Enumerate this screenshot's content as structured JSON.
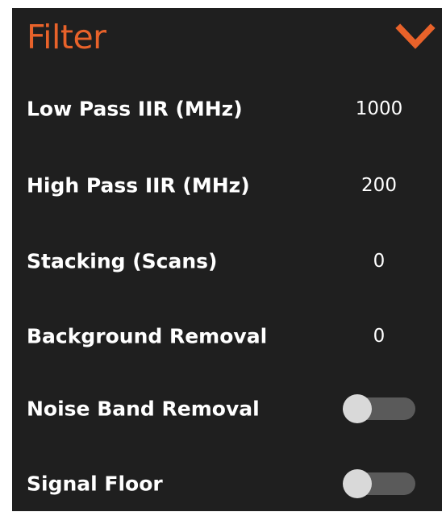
{
  "panel": {
    "title": "Filter",
    "collapse_icon": "chevron-down-icon",
    "accent_color": "#e8622a",
    "background_color": "#1f1f1f"
  },
  "settings": [
    {
      "label": "Low Pass IIR (MHz)",
      "type": "number",
      "value": "1000"
    },
    {
      "label": "High Pass IIR (MHz)",
      "type": "number",
      "value": "200"
    },
    {
      "label": "Stacking (Scans)",
      "type": "number",
      "value": "0"
    },
    {
      "label": "Background Removal",
      "type": "number",
      "value": "0"
    },
    {
      "label": "Noise Band Removal",
      "type": "toggle",
      "on": false
    },
    {
      "label": "Signal Floor",
      "type": "toggle",
      "on": false
    }
  ]
}
